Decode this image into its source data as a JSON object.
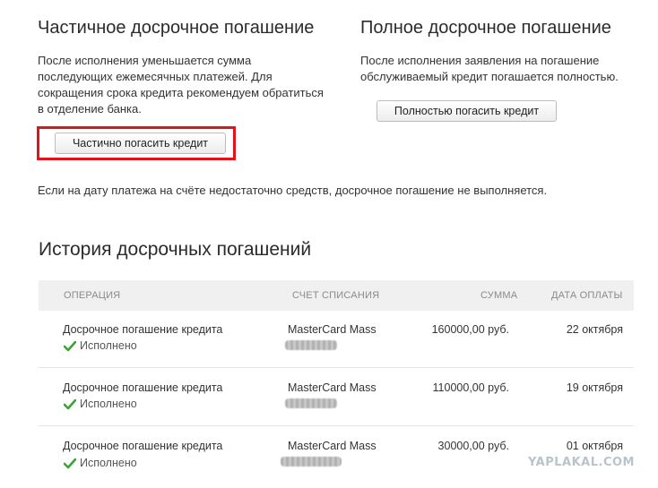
{
  "partial": {
    "title": "Частичное досрочное погашение",
    "desc_lines": [
      "После исполнения уменьшается сумма",
      "последующих ежемесячных платежей. Для",
      "сокращения срока кредита рекомендуем обратиться",
      "в отделение банка."
    ],
    "button_label": "Частично погасить кредит"
  },
  "full": {
    "title": "Полное досрочное погашение",
    "desc_lines": [
      "После исполнения заявления на погашение",
      "обслуживаемый кредит погашается полностью."
    ],
    "button_label": "Полностью погасить кредит"
  },
  "notice": "Если на дату платежа на счёте недостаточно средств, досрочное погашение не выполняется.",
  "history": {
    "title": "История досрочных погашений",
    "columns": [
      "Операция",
      "Счет списания",
      "Сумма",
      "Дата оплаты"
    ],
    "rows": [
      {
        "operation": "Досрочное погашение кредита",
        "status": "Исполнено",
        "account": "MasterCard Mass",
        "amount": "160000,00 руб.",
        "date": "22 октября"
      },
      {
        "operation": "Досрочное погашение кредита",
        "status": "Исполнено",
        "account": "MasterCard Mass",
        "amount": "110000,00 руб.",
        "date": "19 октября"
      },
      {
        "operation": "Досрочное погашение кредита",
        "status": "Исполнено",
        "account": "MasterCard Mass",
        "amount": "30000,00 руб.",
        "date": "01 октября"
      }
    ]
  },
  "watermark": "YAPLAKAL.COM",
  "colors": {
    "highlight": "#e0141b",
    "check": "#3aa335",
    "header_bg": "#f0f0f0"
  }
}
